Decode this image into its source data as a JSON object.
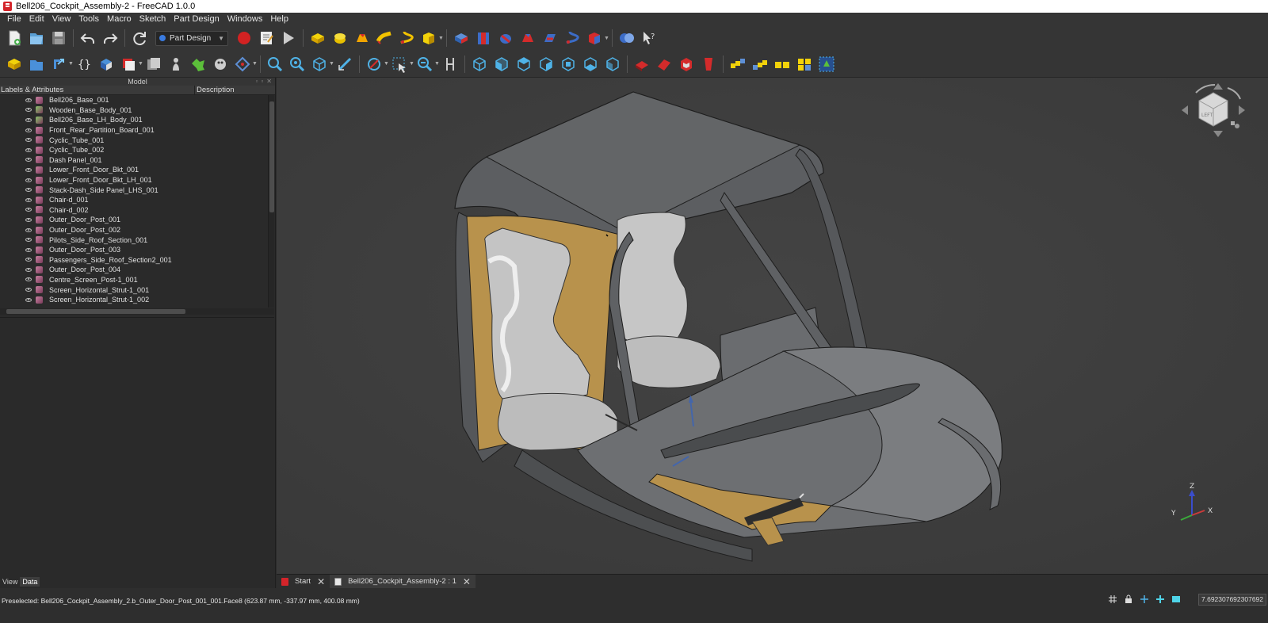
{
  "window": {
    "title": "Bell206_Cockpit_Assembly-2 - FreeCAD 1.0.0"
  },
  "menu": [
    "File",
    "Edit",
    "View",
    "Tools",
    "Macro",
    "Sketch",
    "Part Design",
    "Windows",
    "Help"
  ],
  "toolbar": {
    "workbench": "Part Design"
  },
  "panel": {
    "title": "Model",
    "columns": [
      "Labels & Attributes",
      "Description"
    ],
    "tree": [
      "Bell206_Base_001",
      "Wooden_Base_Body_001",
      "Bell206_Base_LH_Body_001",
      "Front_Rear_Partition_Board_001",
      "Cyclic_Tube_001",
      "Cyclic_Tube_002",
      "Dash Panel_001",
      "Lower_Front_Door_Bkt_001",
      "Lower_Front_Door_Bkt_LH_001",
      "Stack-Dash_Side Panel_LHS_001",
      "Chair-d_001",
      "Chair-d_002",
      "Outer_Door_Post_001",
      "Outer_Door_Post_002",
      "Pilots_Side_Roof_Section_001",
      "Outer_Door_Post_003",
      "Passengers_Side_Roof_Section2_001",
      "Outer_Door_Post_004",
      "Centre_Screen_Post-1_001",
      "Screen_Horizontal_Strut-1_001",
      "Screen_Horizontal_Strut-1_002"
    ],
    "prop_tabs": [
      "View",
      "Data"
    ]
  },
  "doc_tabs": [
    {
      "label": "Start"
    },
    {
      "label": "Bell206_Cockpit_Assembly-2 : 1"
    }
  ],
  "navcube": {
    "face": "LEFT"
  },
  "axes": {
    "z": "Z",
    "y": "Y",
    "x": "X"
  },
  "status": {
    "preselection": "Preselected: Bell206_Cockpit_Assembly_2.b_Outer_Door_Post_001_001.Face8 (623.87 mm, -337.97 mm, 400.08 mm)",
    "zoom": "7.692307692307692"
  }
}
